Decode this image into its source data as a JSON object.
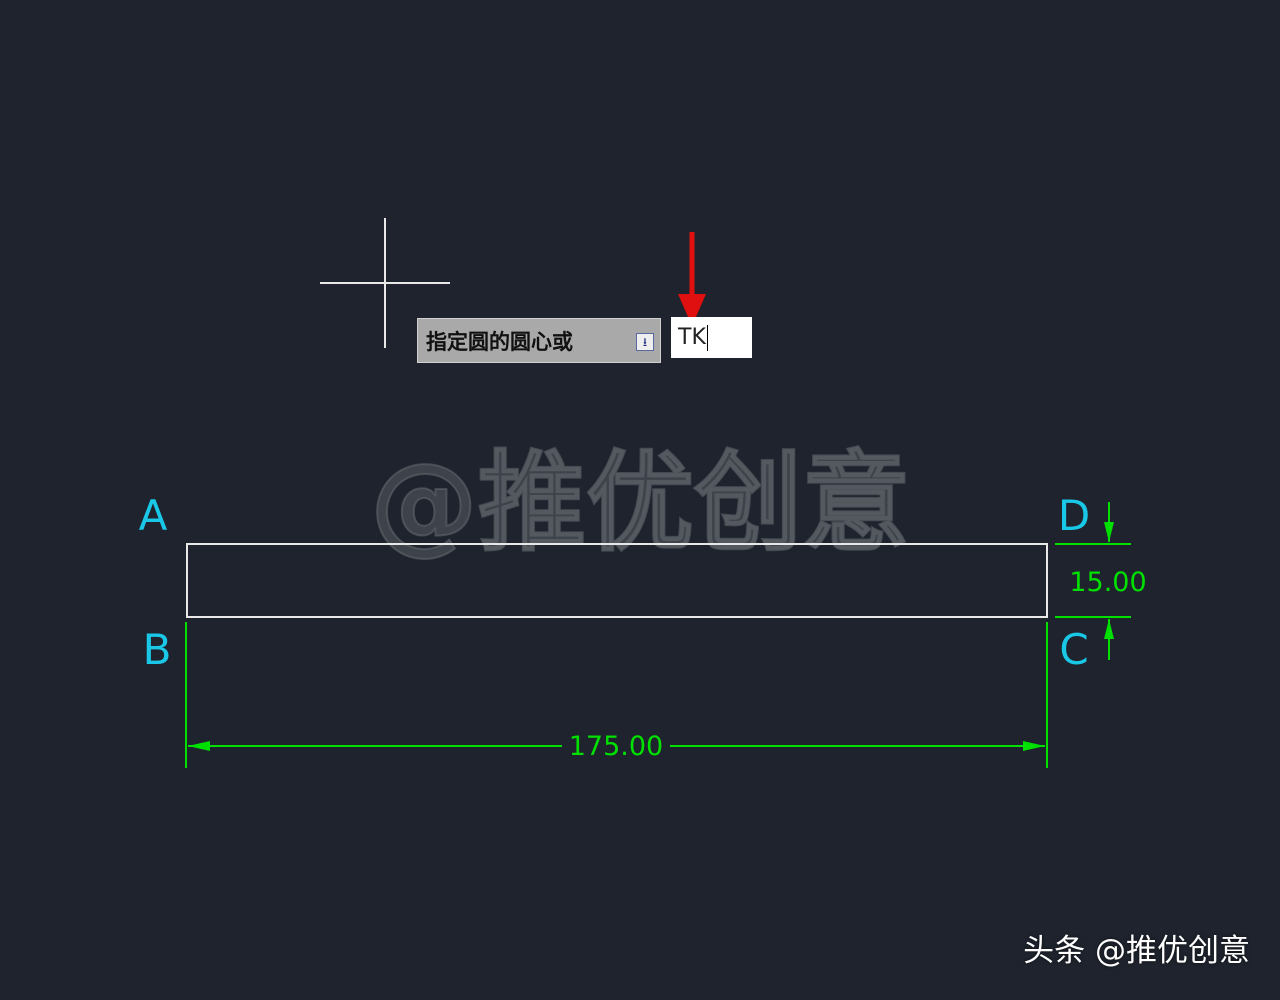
{
  "colors": {
    "background": "#1e232d",
    "geometry": "#e8e8e8",
    "dimension": "#00e000",
    "point_label": "#19c8e6",
    "arrow": "#e01010",
    "watermark": "#5a5d63"
  },
  "prompt": {
    "text": "指定圆的圆心或",
    "expand_icon": "dropdown-arrow-icon"
  },
  "command_input": {
    "value": "TK"
  },
  "points": {
    "a": "A",
    "b": "B",
    "c": "C",
    "d": "D"
  },
  "dimensions": {
    "width": "175.00",
    "height": "15.00"
  },
  "watermark": {
    "center": "@推优创意",
    "footer": "头条 @推优创意"
  }
}
